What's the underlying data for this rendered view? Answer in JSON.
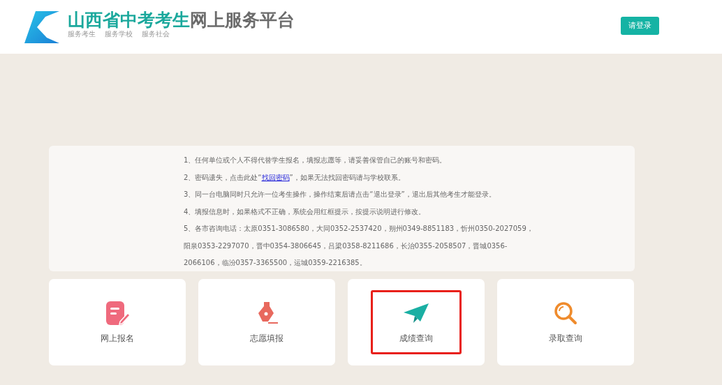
{
  "header": {
    "title_accent": "山西省中考考生",
    "title_rest": "网上服务平台",
    "slogans": [
      "服务考生",
      "服务学校",
      "服务社会"
    ],
    "login_button": "请登录"
  },
  "notices": [
    {
      "kind": "text",
      "text": "1、任何单位或个人不得代替学生报名，填报志愿等，请妥善保管自己的账号和密码。"
    },
    {
      "kind": "link",
      "before": "2、密码遗失，点击此处“",
      "link": "找回密码",
      "after": "”，如果无法找回密码请与学校联系。"
    },
    {
      "kind": "text",
      "text": "3、同一台电脑同时只允许一位考生操作，操作结束后请点击“退出登录”，退出后其他考生才能登录。"
    },
    {
      "kind": "text",
      "text": "4、填报信息时，如果格式不正确，系统会用红框提示，按提示说明进行修改。"
    },
    {
      "kind": "text",
      "text": "5、各市咨询电话：太原0351-3086580，大同0352-2537420，朔州0349-8851183，忻州0350-2027059，阳泉0353-2297070，晋中0354-3806645，吕梁0358-8211686，长治0355-2058507，晋城0356-2066106，临汾0357-3365500，运城0359-2216385。"
    }
  ],
  "tiles": [
    {
      "kind": "register",
      "label": "网上报名",
      "highlighted": false
    },
    {
      "kind": "pen",
      "label": "志愿填报",
      "highlighted": false
    },
    {
      "kind": "plane",
      "label": "成绩查询",
      "highlighted": true
    },
    {
      "kind": "search",
      "label": "录取查询",
      "highlighted": false
    }
  ]
}
